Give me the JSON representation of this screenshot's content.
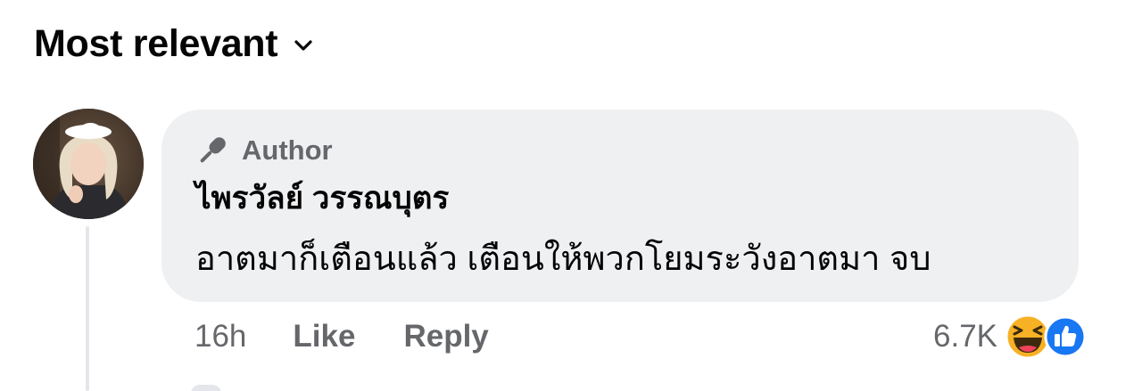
{
  "sort": {
    "label": "Most relevant",
    "icon": "chevron-down-icon"
  },
  "comment": {
    "avatar_icon": "user-avatar",
    "badge": {
      "icon": "microphone-icon",
      "label": "Author"
    },
    "author_name": "ไพรวัลย์ วรรณบุตร",
    "text": "อาตมาก็เตือนแล้ว เตือนให้พวกโยมระวังอาตมา จบ",
    "timestamp": "16h",
    "actions": {
      "like": "Like",
      "reply": "Reply"
    },
    "reactions": {
      "count": "6.7K",
      "types": [
        "haha-icon",
        "like-icon"
      ]
    }
  },
  "colors": {
    "bubble_bg": "#eff0f2",
    "secondary_text": "#65676b",
    "primary_text": "#050505",
    "like_blue": "#1877f2",
    "haha_yellow": "#f7b125"
  }
}
